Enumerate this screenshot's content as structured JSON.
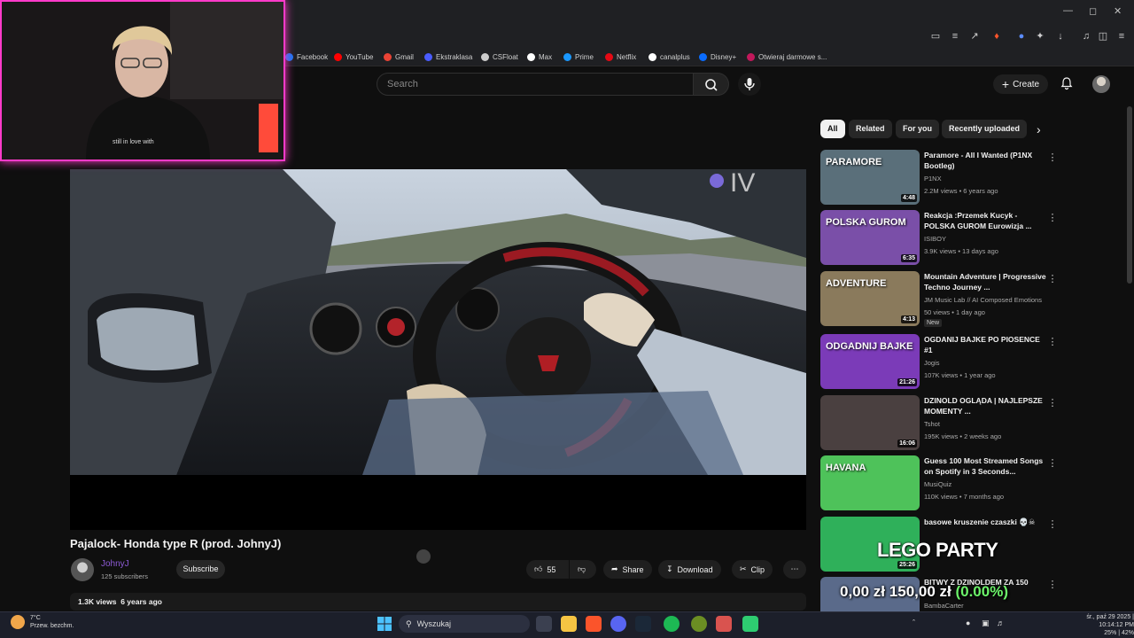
{
  "browser": {
    "bookmarks": [
      {
        "label": "Facebook",
        "color": "#1877f2"
      },
      {
        "label": "YouTube",
        "color": "#ff0000"
      },
      {
        "label": "Gmail",
        "color": "#ea4335"
      },
      {
        "label": "Ekstraklasa",
        "color": "#4a5cff"
      },
      {
        "label": "CSFloat",
        "color": "#cccccc"
      },
      {
        "label": "Max",
        "color": "#ffffff"
      },
      {
        "label": "Prime",
        "color": "#1a98ff"
      },
      {
        "label": "Netflix",
        "color": "#e50914"
      },
      {
        "label": "canalplus",
        "color": "#ffffff"
      },
      {
        "label": "Disney+",
        "color": "#0a6cff"
      },
      {
        "label": "Otwieraj darmowe s...",
        "color": "#c2185b"
      }
    ]
  },
  "header": {
    "search_placeholder": "Search",
    "create_label": "Create"
  },
  "video": {
    "title": "Pajalock- Honda type R (prod. JohnyJ)",
    "channel": "JohnyJ",
    "subscribers": "125 subscribers",
    "subscribe_label": "Subscribe",
    "likes": "55",
    "share_label": "Share",
    "download_label": "Download",
    "clip_label": "Clip",
    "views": "1.3K views",
    "age": "6 years ago"
  },
  "chips": [
    "All",
    "Related",
    "For you",
    "Recently uploaded"
  ],
  "recommendations": [
    {
      "title": "Paramore - All I Wanted (P1NX Bootleg)",
      "channel": "P1NX",
      "meta": "2.2M views • 6 years ago",
      "duration": "4:48",
      "thumb_text": "PARAMORE",
      "thumb_color": "#5a6f7a"
    },
    {
      "title": "Reakcja :Przemek Kucyk - POLSKA GUROM Eurowizja ...",
      "channel": "ISIBOY",
      "meta": "3.9K views • 13 days ago",
      "duration": "6:35",
      "thumb_text": "POLSKA GUROM",
      "thumb_color": "#7a4fa8"
    },
    {
      "title": "Mountain Adventure | Progressive Techno Journey ...",
      "channel": "JM Music Lab // AI Composed Emotions",
      "meta": "50 views • 1 day ago",
      "duration": "4:13",
      "badge": "New",
      "thumb_text": "ADVENTURE",
      "thumb_color": "#8a7a5c"
    },
    {
      "title": "OGDANIJ BAJKE PO PIOSENCE #1",
      "channel": "Jogis",
      "meta": "107K views • 1 year ago",
      "duration": "21:26",
      "thumb_text": "ODGADNIJ BAJKE",
      "thumb_color": "#7b3bb8"
    },
    {
      "title": "DZINOLD OGLĄDA | NAJLEPSZE MOMENTY ...",
      "channel": "Tshot",
      "meta": "195K views • 2 weeks ago",
      "duration": "16:06",
      "thumb_text": "",
      "thumb_color": "#4a4040"
    },
    {
      "title": "Guess 100 Most Streamed Songs on Spotify in 3 Seconds...",
      "channel": "MusiQuiz",
      "meta": "110K views • 7 months ago",
      "duration": "",
      "thumb_text": "HAVANA",
      "thumb_color": "#4ec25a"
    },
    {
      "title": "basowe kruszenie czaszki 💀☠",
      "channel": "",
      "meta": "",
      "duration": "25:26",
      "thumb_text": "",
      "thumb_color": "#2fb05a"
    },
    {
      "title": "BITWY Z DZINOLDEM ZA 150",
      "channel": "BambaCarter",
      "meta": "",
      "duration": "",
      "thumb_text": "",
      "thumb_color": "#5a6a8a"
    }
  ],
  "overlays": {
    "lego": "LEGO PARTY",
    "ticker_left": "0,00 zł",
    "ticker_mid": "150,00 zł",
    "ticker_pct": "(0.00%)"
  },
  "taskbar": {
    "temp": "7°C",
    "weather": "Przew. bezchm.",
    "search": "Wyszukaj",
    "time": "10:14:12 PM",
    "date": "śr., paź 29 2025",
    "battery": "25% | 42%"
  }
}
